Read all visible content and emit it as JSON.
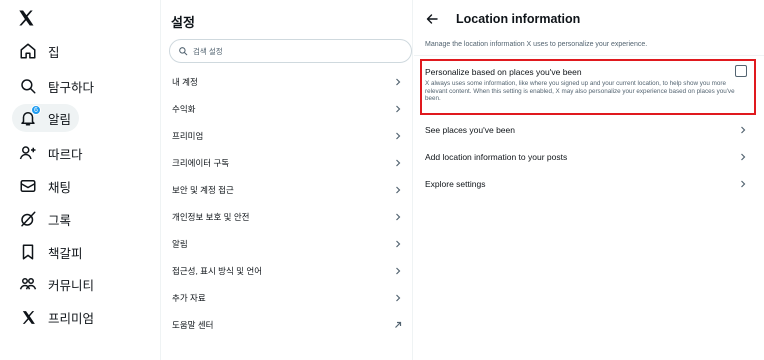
{
  "nav": {
    "items": [
      {
        "icon": "home-icon",
        "label": "집"
      },
      {
        "icon": "search-icon",
        "label": "탐구하다"
      },
      {
        "icon": "bell-icon",
        "label": "알림",
        "badge": "6"
      },
      {
        "icon": "follow-icon",
        "label": "따르다"
      },
      {
        "icon": "mail-icon",
        "label": "채팅"
      },
      {
        "icon": "grok-icon",
        "label": "그록"
      },
      {
        "icon": "bookmark-icon",
        "label": "책갈피"
      },
      {
        "icon": "communities-icon",
        "label": "커뮤니티"
      },
      {
        "icon": "x-logo-icon",
        "label": "프리미엄"
      }
    ]
  },
  "settings": {
    "title": "설정",
    "search_placeholder": "검색 설정",
    "items": [
      {
        "label": "내 계정",
        "icon": "chevron-right-icon"
      },
      {
        "label": "수익화",
        "icon": "chevron-right-icon"
      },
      {
        "label": "프리미엄",
        "icon": "chevron-right-icon"
      },
      {
        "label": "크리에이터 구독",
        "icon": "chevron-right-icon"
      },
      {
        "label": "보안 및 계정 접근",
        "icon": "chevron-right-icon"
      },
      {
        "label": "개인정보 보호 및 안전",
        "icon": "chevron-right-icon"
      },
      {
        "label": "알림",
        "icon": "chevron-right-icon"
      },
      {
        "label": "접근성, 표시 방식 및 언어",
        "icon": "chevron-right-icon"
      },
      {
        "label": "추가 자료",
        "icon": "chevron-right-icon"
      },
      {
        "label": "도움말 센터",
        "icon": "external-link-icon"
      }
    ]
  },
  "detail": {
    "title": "Location information",
    "description": "Manage the location information X uses to personalize your experience.",
    "option": {
      "title": "Personalize based on places you've been",
      "description": "X always uses some information, like where you signed up and your current location, to help show you more relevant content. When this setting is enabled, X may also personalize your experience based on places you've been.",
      "checked": false
    },
    "rows": [
      {
        "label": "See places you've been"
      },
      {
        "label": "Add location information to your posts"
      },
      {
        "label": "Explore settings"
      }
    ]
  },
  "colors": {
    "accent": "#1d9bf0",
    "highlight_border": "#e0191e",
    "muted_text": "#536471"
  }
}
